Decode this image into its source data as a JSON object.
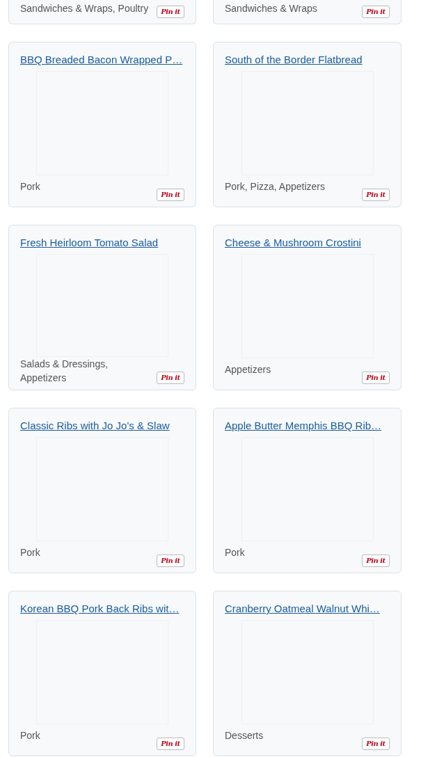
{
  "partial_cards": [
    {
      "category": "Sandwiches & Wraps, Poultry",
      "pin_label": "Pin it"
    },
    {
      "category": "Sandwiches & Wraps",
      "pin_label": "Pin it"
    }
  ],
  "cards": [
    {
      "title": "BBQ Breaded Bacon Wrapped P…",
      "category": "Pork",
      "pin_label": "Pin it"
    },
    {
      "title": "South of the Border Flatbread",
      "category": "Pork, Pizza, Appetizers",
      "pin_label": "Pin it"
    },
    {
      "title": "Fresh Heirloom Tomato Salad",
      "category": "Salads & Dressings, Appetizers",
      "pin_label": "Pin it"
    },
    {
      "title": "Cheese & Mushroom Crostini",
      "category": "Appetizers",
      "pin_label": "Pin it"
    },
    {
      "title": "Classic Ribs with Jo Jo's & Slaw",
      "category": "Pork",
      "pin_label": "Pin it"
    },
    {
      "title": "Apple Butter Memphis BBQ Rib…",
      "category": "Pork",
      "pin_label": "Pin it"
    },
    {
      "title": "Korean BBQ Pork Back Ribs wit…",
      "category": "Pork",
      "pin_label": "Pin it"
    },
    {
      "title": "Cranberry Oatmeal Walnut Whi…",
      "category": "Desserts",
      "pin_label": "Pin it"
    }
  ]
}
